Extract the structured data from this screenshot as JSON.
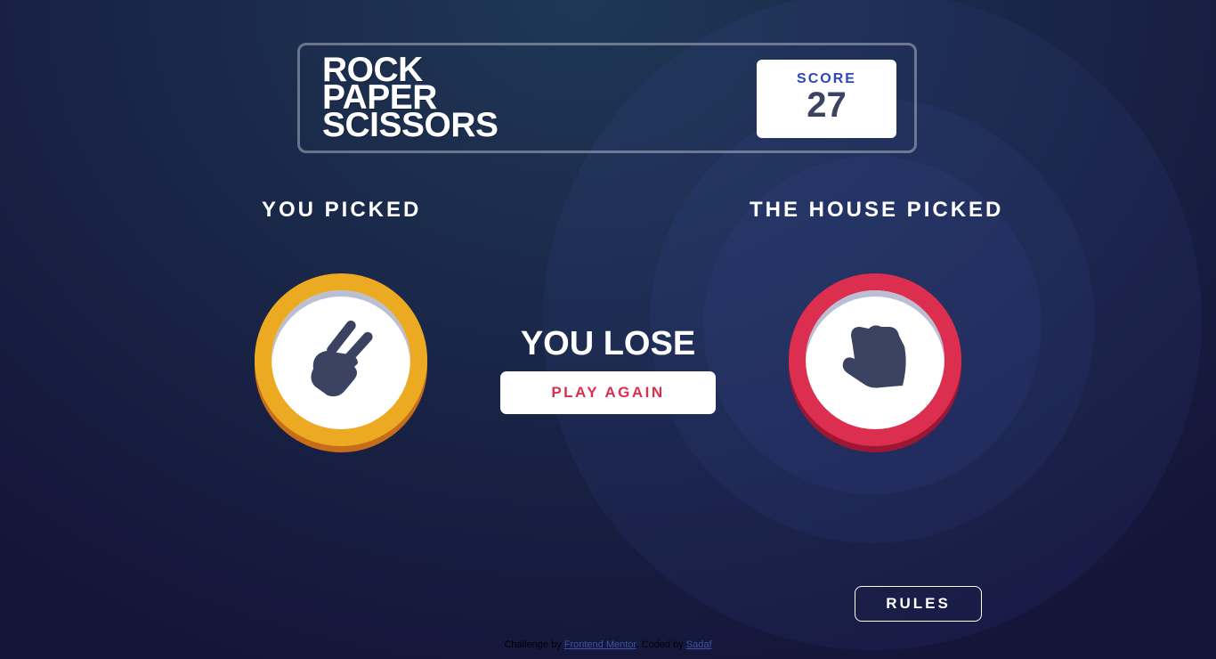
{
  "header": {
    "title_lines": [
      "ROCK",
      "PAPER",
      "SCISSORS"
    ],
    "score_label": "SCORE",
    "score_value": "27"
  },
  "player": {
    "title": "YOU PICKED",
    "choice": "scissors",
    "icon": "scissors-hand-icon",
    "color": "#eca922"
  },
  "house": {
    "title": "THE HOUSE PICKED",
    "choice": "rock",
    "icon": "rock-fist-icon",
    "color": "#dc2e4e"
  },
  "result": {
    "text": "YOU LOSE",
    "play_again_label": "PLAY AGAIN"
  },
  "rules_label": "RULES",
  "attribution": {
    "prefix": "Challenge by ",
    "link1": "Frontend Mentor",
    "middle": ". Coded by ",
    "link2": "Sadaf"
  }
}
